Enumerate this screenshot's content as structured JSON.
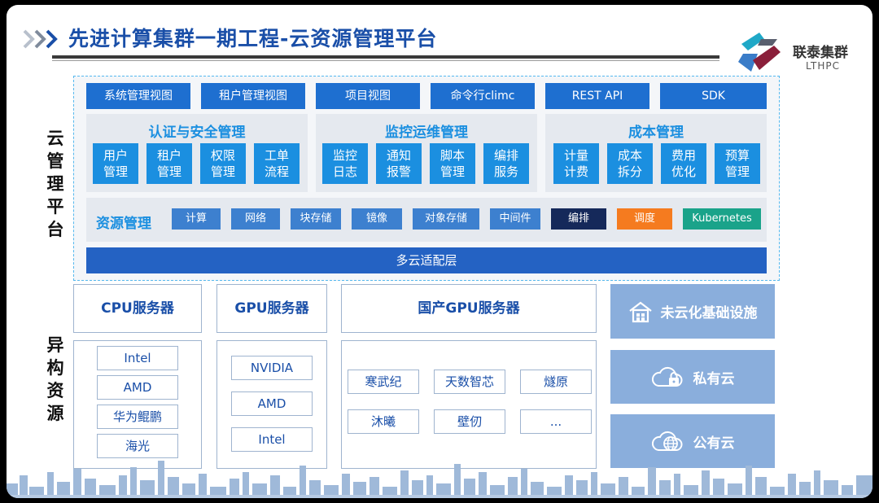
{
  "header": {
    "title": "先进计算集群一期工程-云资源管理平台",
    "logo_name": "联泰集群",
    "logo_sub": "LTHPC"
  },
  "side_labels": {
    "cloud_platform": [
      "云",
      "管",
      "理",
      "平",
      "台"
    ],
    "hetero": [
      "异",
      "构",
      "资",
      "源"
    ]
  },
  "views": [
    "系统管理视图",
    "租户管理视图",
    "项目视图",
    "命令行climc",
    "REST API",
    "SDK"
  ],
  "groups": [
    {
      "title": "认证与安全管理",
      "tiles": [
        "用户管理",
        "租户管理",
        "权限管理",
        "工单流程"
      ]
    },
    {
      "title": "监控运维管理",
      "tiles": [
        "监控日志",
        "通知报警",
        "脚本管理",
        "编排服务"
      ]
    },
    {
      "title": "成本管理",
      "tiles": [
        "计量计费",
        "成本拆分",
        "费用优化",
        "预算管理"
      ]
    }
  ],
  "resource_management": {
    "title": "资源管理",
    "chips": [
      "计算",
      "网络",
      "块存储",
      "镜像",
      "对象存储",
      "中间件",
      "编排",
      "调度",
      "Kubernetes"
    ]
  },
  "multicloud_layer": "多云适配层",
  "servers": {
    "cpu": {
      "title": "CPU服务器",
      "items": [
        "Intel",
        "AMD",
        "华为鲲鹏",
        "海光"
      ]
    },
    "gpu": {
      "title": "GPU服务器",
      "items": [
        "NVIDIA",
        "AMD",
        "Intel"
      ]
    },
    "domestic_gpu": {
      "title": "国产GPU服务器",
      "items": [
        "寒武纪",
        "天数智芯",
        "燧原",
        "沐曦",
        "壁仞",
        "..."
      ]
    }
  },
  "infra": [
    {
      "label": "未云化基础设施",
      "icon": "house-icon"
    },
    {
      "label": "私有云",
      "icon": "cloud-lock-icon"
    },
    {
      "label": "公有云",
      "icon": "cloud-globe-icon"
    }
  ],
  "colors": {
    "primary_blue": "#1e6fd0",
    "tile_blue": "#1b8fe0",
    "chip_blue": "#3d80cf",
    "chip_navy": "#15295a",
    "chip_orange": "#f57b1f",
    "chip_teal": "#1aa38a",
    "infra_card": "#8aaedc",
    "title_blue": "#1a4fa8"
  }
}
